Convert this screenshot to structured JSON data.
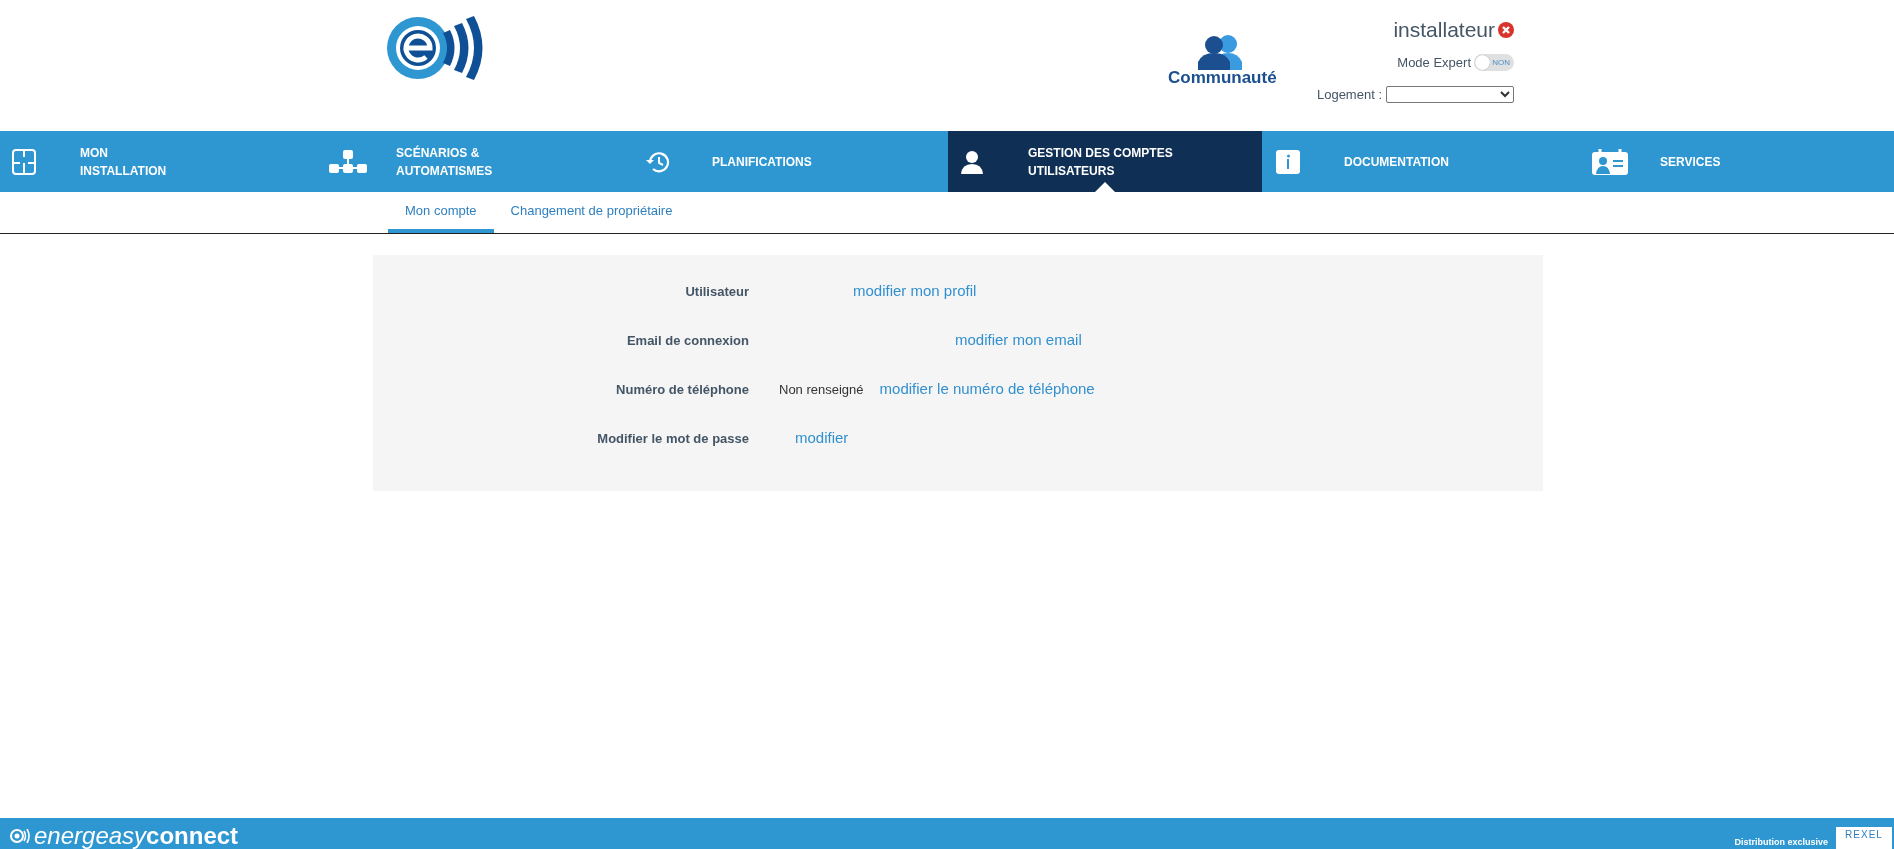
{
  "header": {
    "community_label": "Communauté",
    "user": "installateur",
    "expert_mode": {
      "label": "Mode Expert",
      "state_text": "NON",
      "on": false
    },
    "housing": {
      "label": "Logement :"
    }
  },
  "nav": [
    {
      "kind": "installation",
      "label": "MON\nINSTALLATION",
      "selected": false
    },
    {
      "kind": "scenarios",
      "label": "SCÉNARIOS &\nAUTOMATISMES",
      "selected": false
    },
    {
      "kind": "schedule",
      "label": "PLANIFICATIONS",
      "selected": false
    },
    {
      "kind": "accounts",
      "label": "GESTION DES COMPTES\nUTILISATEURS",
      "selected": true
    },
    {
      "kind": "documentation",
      "label": "DOCUMENTATION",
      "selected": false
    },
    {
      "kind": "services",
      "label": "SERVICES",
      "selected": false
    }
  ],
  "subtabs": [
    {
      "label": "Mon compte",
      "selected": true
    },
    {
      "label": "Changement de propriétaire",
      "selected": false
    }
  ],
  "account": [
    {
      "label": "Utilisateur",
      "link": "modifier mon profil"
    },
    {
      "label": "Email de connexion",
      "link": "modifier mon email"
    },
    {
      "label": "Numéro de téléphone",
      "value": "Non renseigné",
      "link": "modifier le numéro de téléphone"
    },
    {
      "label": "Modifier le mot de passe",
      "link": "modifier"
    }
  ],
  "footer": {
    "brand_light": "energeasy",
    "brand_bold": "connect",
    "distribution": "Distribution exclusive",
    "partner": "REXEL"
  }
}
